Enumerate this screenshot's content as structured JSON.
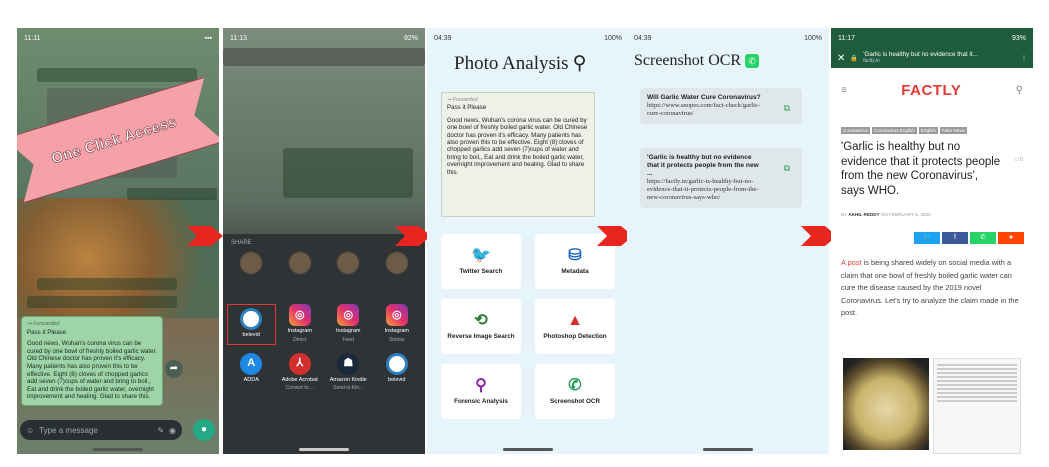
{
  "banner": {
    "text": "One Click Access"
  },
  "phone1": {
    "time": "11:11",
    "forwarded": "Forwarded",
    "greeting": "Pass it Please",
    "message": "Good news, Wuhan's corona virus can be cured by one bowl of freshly boiled garlic water. Old Chinese doctor has proven it's efficacy. Many patients has also proven this to be effective. Eight (8) cloves of chopped garlics add seven (7)cups of water and bring to boil,, Eat and drink the boiled garlic water, overnight improvement and healing. Glad to share this.",
    "composer_placeholder": "Type a message"
  },
  "phone2": {
    "time": "11:13",
    "battery": "92%",
    "share_title": "SHARE",
    "apps": [
      {
        "name": "belevid",
        "sub": "",
        "icon": "eye-icon"
      },
      {
        "name": "Instagram",
        "sub": "Direct",
        "icon": "instagram-icon"
      },
      {
        "name": "Instagram",
        "sub": "Feed",
        "icon": "instagram-icon"
      },
      {
        "name": "Instagram",
        "sub": "Stories",
        "icon": "instagram-icon"
      },
      {
        "name": "ADDA",
        "sub": "",
        "icon": "adda-icon"
      },
      {
        "name": "Adobe Acrobat",
        "sub": "Convert to ...",
        "icon": "acrobat-icon"
      },
      {
        "name": "Amazon Kindle",
        "sub": "Send to Kin...",
        "icon": "kindle-icon"
      },
      {
        "name": "belevid",
        "sub": "",
        "icon": "eye-icon"
      }
    ]
  },
  "phone3": {
    "time": "04:39",
    "battery": "100%",
    "title": "Photo Analysis",
    "card_forwarded": "Forwarded",
    "card_greeting": "Pass it Please",
    "card_message": "Good news, Wuhan's corona virus can be cured by one bowl of freshly boiled garlic water. Old Chinese doctor has proven it's efficacy. Many patients has also proven this to be effective. Eight (8) cloves of chopped garlics add seven (7)cups of water and bring to boil,, Eat and drink the boiled garlic water, overnight improvement and healing. Glad to share this.",
    "tools": [
      {
        "label": "Twitter Search",
        "icon": "twitter-icon"
      },
      {
        "label": "Metadata",
        "icon": "database-icon"
      },
      {
        "label": "Reverse Image Search",
        "icon": "reverse-search-icon"
      },
      {
        "label": "Photoshop Detection",
        "icon": "adobe-icon"
      },
      {
        "label": "Forensic Analysis",
        "icon": "forensic-icon"
      },
      {
        "label": "Screenshot OCR",
        "icon": "whatsapp-icon"
      }
    ]
  },
  "phone4": {
    "time": "04:39",
    "battery": "100%",
    "title": "Screenshot OCR",
    "results": [
      {
        "title": "Will Garlic Water Cure Coronavirus?",
        "url": "https://www.snopes.com/fact-check/garlic-cure-coronavirus/"
      },
      {
        "title": "'Garlic is healthy but no evidence that it protects people from the new ...",
        "url": "https://factly.in/garlic-is-healthy-but-no-evidence-that-it-protects-people-from-the-new-coronavirus-says-who/"
      }
    ]
  },
  "phone5": {
    "time": "11:17",
    "battery": "93%",
    "tab_title": "'Garlic is healthy but no evidence that it...",
    "tab_domain": "factly.in",
    "logo": "FACTLY",
    "tags": [
      "Coronavirus",
      "Coronavirus English",
      "English",
      "Fake News"
    ],
    "headline": "'Garlic is healthy but no evidence that it protects people from the new Coronavirus', says WHO.",
    "comments": "0",
    "byline_prefix": "BY",
    "author": "AKHIL REDDY",
    "date": "ON FEBRUARY 5, 2020",
    "body_link": "A post",
    "body": " is being shared widely on social media with a claim that one bowl of freshly boiled garlic water can cure the disease caused by the 2019 novel Coronavirus. Let's try to analyze the claim made in the post."
  },
  "colors": {
    "arrow": "#e8261f",
    "whatsapp": "#25d366",
    "factly_red": "#e53935"
  }
}
